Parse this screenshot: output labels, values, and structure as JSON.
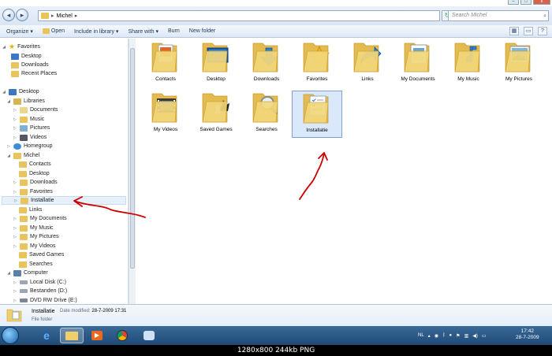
{
  "address": {
    "path": [
      "Michel"
    ],
    "separator": "▸"
  },
  "search": {
    "placeholder": "Search Michel"
  },
  "toolbar": {
    "organize": "Organize ▾",
    "open": "Open",
    "include": "Include in library ▾",
    "share": "Share with ▾",
    "burn": "Burn",
    "new_folder": "New folder"
  },
  "nav": {
    "favorites": "Favorites",
    "desktop_fav": "Desktop",
    "downloads_fav": "Downloads",
    "recent": "Recent Places",
    "desktop": "Desktop",
    "libraries": "Libraries",
    "documents": "Documents",
    "music": "Music",
    "pictures": "Pictures",
    "videos": "Videos",
    "homegroup": "Homegroup",
    "michel": "Michel",
    "contacts": "Contacts",
    "desktop_u": "Desktop",
    "downloads_u": "Downloads",
    "favorites_u": "Favorites",
    "installatie": "Installatie",
    "links": "Links",
    "mydocs": "My Documents",
    "mymusic": "My Music",
    "mypics": "My Pictures",
    "myvideos": "My Videos",
    "savedgames": "Saved Games",
    "searches": "Searches",
    "computer": "Computer",
    "localc": "Local Disk (C:)",
    "bestanden": "Bestanden (D:)",
    "dvd": "DVD RW Drive (E:)"
  },
  "folders": [
    {
      "label": "Contacts",
      "icon": "contacts-icon"
    },
    {
      "label": "Desktop",
      "icon": "desktop-icon"
    },
    {
      "label": "Downloads",
      "icon": "download-arrow-icon"
    },
    {
      "label": "Favorites",
      "icon": "star-icon"
    },
    {
      "label": "Links",
      "icon": "link-arrow-icon"
    },
    {
      "label": "My Documents",
      "icon": "document-icon"
    },
    {
      "label": "My Music",
      "icon": "music-note-icon"
    },
    {
      "label": "My Pictures",
      "icon": "picture-icon"
    },
    {
      "label": "My Videos",
      "icon": "film-icon"
    },
    {
      "label": "Saved Games",
      "icon": "chess-icon"
    },
    {
      "label": "Searches",
      "icon": "magnifier-icon"
    },
    {
      "label": "Installatie",
      "icon": "checklist-icon"
    }
  ],
  "details": {
    "name": "Installatie",
    "modified_label": "Date modified:",
    "modified_value": "28-7-2009 17:31",
    "type": "File folder"
  },
  "tray": {
    "lang": "NL",
    "time": "17:42",
    "date": "28-7-2009"
  },
  "footer": {
    "caption": "1280x800  244kb  PNG"
  },
  "colors": {
    "folder": "#f0cf6a",
    "selection": "#d9e8fb",
    "taskbar": "#2b5885",
    "annotation": "#cc0000"
  }
}
